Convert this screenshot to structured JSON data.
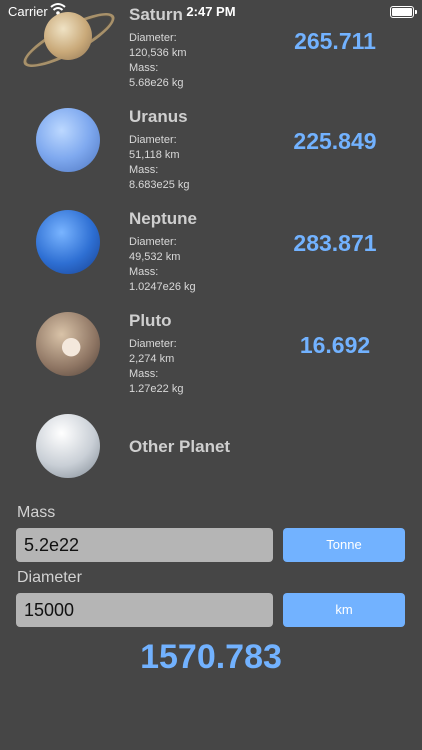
{
  "status_bar": {
    "carrier": "Carrier",
    "time": "2:47 PM"
  },
  "planets": [
    {
      "name": "Saturn",
      "diameter_label": "Diameter:",
      "diameter": "120,536 km",
      "mass_label": "Mass:",
      "mass": "5.68e26 kg",
      "value": "265.711"
    },
    {
      "name": "Uranus",
      "diameter_label": "Diameter:",
      "diameter": "51,118 km",
      "mass_label": "Mass:",
      "mass": "8.683e25 kg",
      "value": "225.849"
    },
    {
      "name": "Neptune",
      "diameter_label": "Diameter:",
      "diameter": "49,532 km",
      "mass_label": "Mass:",
      "mass": "1.0247e26 kg",
      "value": "283.871"
    },
    {
      "name": "Pluto",
      "diameter_label": "Diameter:",
      "diameter": "2,274 km",
      "mass_label": "Mass:",
      "mass": "1.27e22 kg",
      "value": "16.692"
    },
    {
      "name": "Other Planet"
    }
  ],
  "form": {
    "mass_label": "Mass",
    "mass_value": "5.2e22",
    "mass_unit": "Tonne",
    "diameter_label": "Diameter",
    "diameter_value": "15000",
    "diameter_unit": "km"
  },
  "result": "1570.783",
  "colors": {
    "background": "#464646",
    "accent": "#72b2ff",
    "input": "#b5b5b5"
  }
}
